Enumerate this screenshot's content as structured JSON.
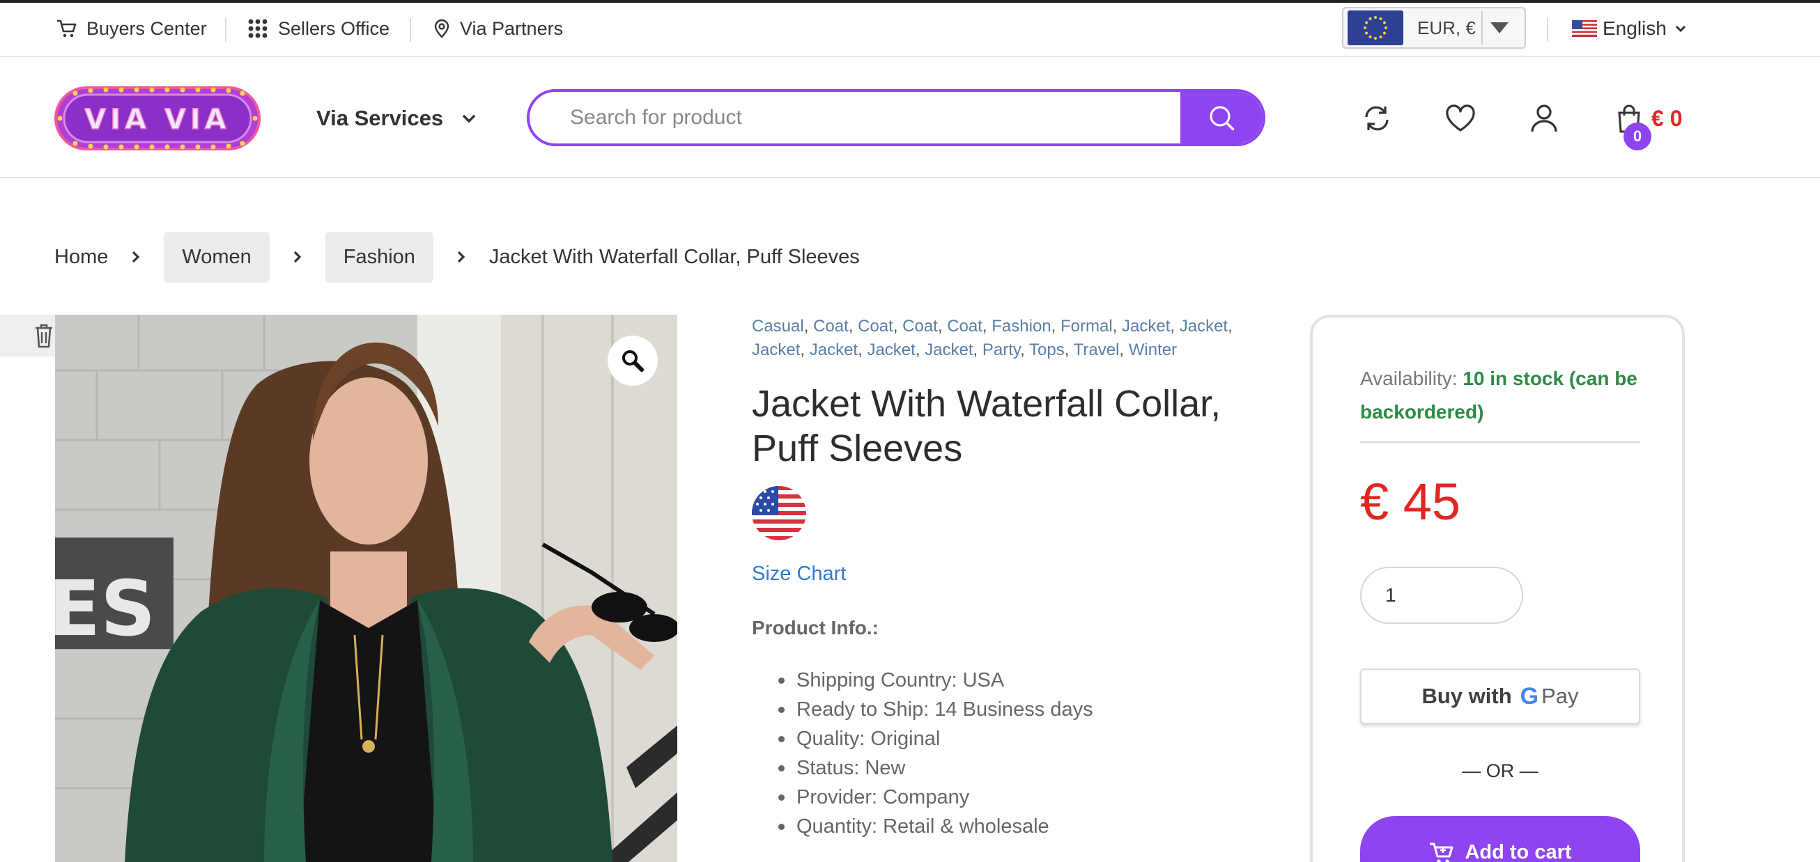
{
  "topbar": {
    "buyers_center": "Buyers Center",
    "sellers_office": "Sellers Office",
    "via_partners": "Via Partners",
    "currency": "EUR, €",
    "language": "English"
  },
  "header": {
    "logo_text": "VIA VIA",
    "services_label": "Via Services",
    "search_placeholder": "Search for product",
    "cart_count": "0",
    "cart_total": "€ 0"
  },
  "breadcrumb": {
    "home": "Home",
    "women": "Women",
    "fashion": "Fashion",
    "current": "Jacket With Waterfall Collar, Puff Sleeves"
  },
  "product": {
    "tags": [
      "Casual",
      "Coat",
      "Coat",
      "Coat",
      "Coat",
      "Fashion",
      "Formal",
      "Jacket",
      "Jacket",
      "Jacket",
      "Jacket",
      "Jacket",
      "Jacket",
      "Party",
      "Tops",
      "Travel",
      "Winter"
    ],
    "title": "Jacket With Waterfall Collar, Puff Sleeves",
    "size_chart": "Size Chart",
    "info_title": "Product Info.:",
    "info": [
      "Shipping Country: USA",
      "Ready to Ship: 14 Business days",
      "Quality: Original",
      "Status: New",
      "Provider: Company",
      "Quantity: Retail & wholesale"
    ]
  },
  "buybox": {
    "availability_label": "Availability:",
    "availability_value": "10 in stock (can be backordered)",
    "price": "€ 45",
    "quantity": "1",
    "gpay_prefix": "Buy with",
    "gpay_g": "G",
    "gpay_suffix": "Pay",
    "or_text": "— OR —",
    "add_to_cart": "Add to cart"
  },
  "colors": {
    "accent": "#8e44f0",
    "price": "#e0271f",
    "in_stock": "#2f8a45",
    "link": "#2f7ad0"
  }
}
